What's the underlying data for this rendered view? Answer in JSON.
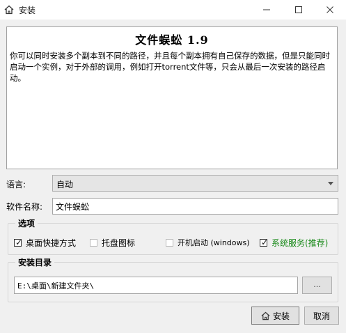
{
  "window": {
    "title": "安装",
    "app_icon": "home-icon",
    "controls": [
      "minimize-icon",
      "maximize-icon",
      "close-icon"
    ]
  },
  "description": {
    "title": "文件蜈蚣 1.9",
    "body": "你可以同时安装多个副本到不同的路径，并且每个副本拥有自己保存的数据，但是只能同时启动一个实例，对于外部的调用，例如打开torrent文件等，只会从最后一次安装的路径启动。"
  },
  "language": {
    "label": "语言:",
    "value": "自动"
  },
  "software_name": {
    "label": "软件名称:",
    "value": "文件蜈蚣"
  },
  "options": {
    "title": "选项",
    "items": [
      {
        "label": "桌面快捷方式",
        "checked": true
      },
      {
        "label": "托盘图标",
        "checked": false
      },
      {
        "label": "开机启动 (windows)",
        "checked": false
      },
      {
        "label": "系统服务(推荐)",
        "checked": true,
        "color": "#1a8a1a"
      }
    ]
  },
  "install_dir": {
    "title": "安装目录",
    "value": "E:\\桌面\\新建文件夹\\",
    "browse_label": "..."
  },
  "buttons": {
    "install": "安装",
    "cancel": "取消"
  }
}
